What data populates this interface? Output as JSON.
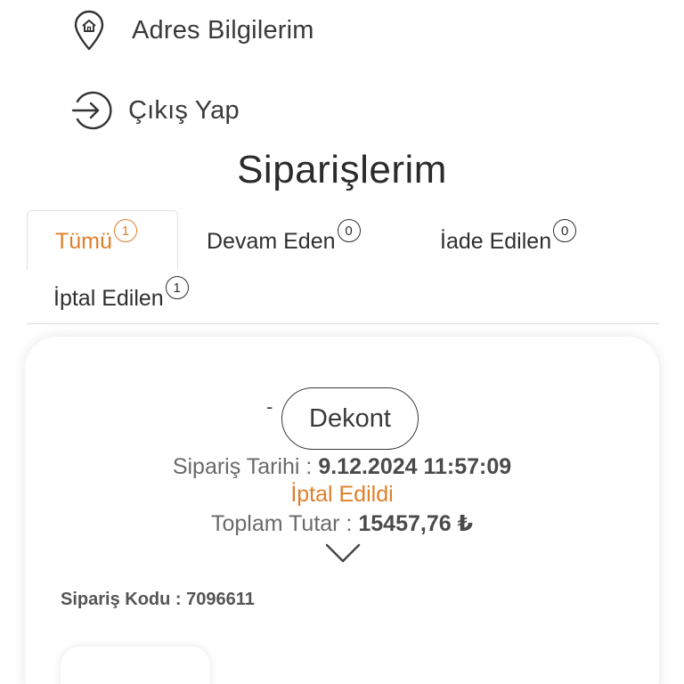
{
  "menu": {
    "address_label": "Adres Bilgilerim",
    "logout_label": "Çıkış Yap"
  },
  "page_title": "Siparişlerim",
  "tabs": [
    {
      "label": "Tümü",
      "count": "1",
      "active": true
    },
    {
      "label": "Devam Eden",
      "count": "0",
      "active": false
    },
    {
      "label": "İade Edilen",
      "count": "0",
      "active": false
    },
    {
      "label": "İptal Edilen",
      "count": "1",
      "active": false
    }
  ],
  "order": {
    "dash": "-",
    "receipt_label": "Dekont",
    "date_label": "Sipariş Tarihi : ",
    "date_value": "9.12.2024 11:57:09",
    "status": "İptal Edildi",
    "total_label": "Toplam Tutar : ",
    "total_value": "15457,76 ₺",
    "code_label": "Sipariş Kodu : ",
    "code_value": "7096611"
  },
  "colors": {
    "accent": "#e07f2a",
    "text": "#333333"
  },
  "icons": {
    "address": "home-location-icon",
    "logout": "logout-arrow-icon",
    "expand": "chevron-down-icon"
  }
}
